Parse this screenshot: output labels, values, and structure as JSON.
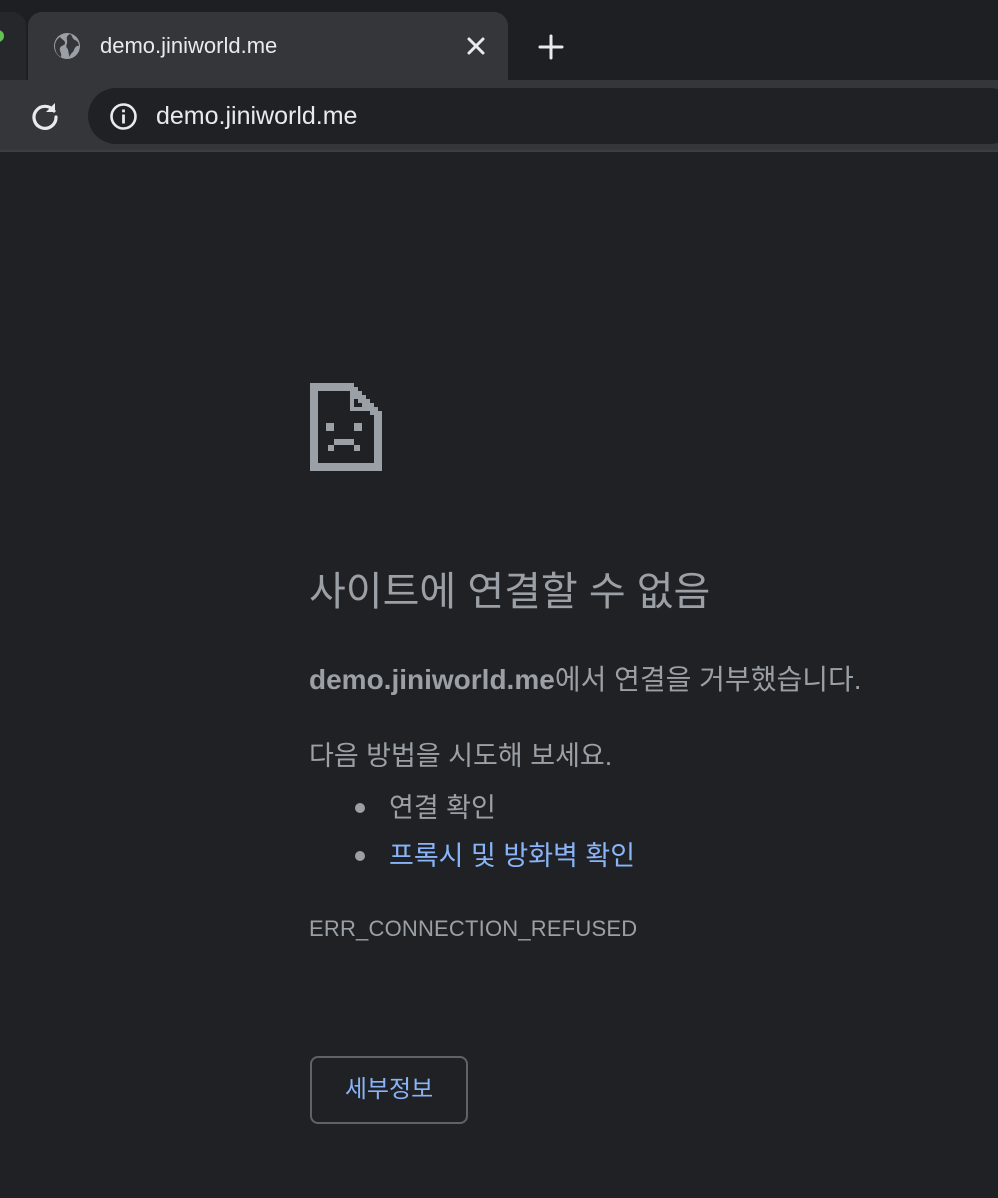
{
  "colors": {
    "tabstrip": "#1e1f22",
    "active_tab": "#35363a",
    "page_background": "#202124",
    "text_secondary": "#9aa0a6",
    "link": "#8ab4f8",
    "button_border": "#5f6368"
  },
  "browser": {
    "tab": {
      "title": "demo.jiniworld.me",
      "favicon": "globe-icon",
      "close_icon": "close-icon"
    },
    "new_tab_icon": "plus-icon",
    "toolbar": {
      "reload_icon": "reload-icon",
      "info_icon": "info-icon",
      "url": "demo.jiniworld.me"
    }
  },
  "error_page": {
    "icon": "sad-page-icon",
    "heading": "사이트에 연결할 수 없음",
    "summary_host": "demo.jiniworld.me",
    "summary_text": "에서 연결을 거부했습니다.",
    "suggestions_title": "다음 방법을 시도해 보세요.",
    "suggestions": [
      {
        "label": "연결 확인",
        "is_link": false
      },
      {
        "label": "프록시 및 방화벽 확인",
        "is_link": true
      }
    ],
    "error_code": "ERR_CONNECTION_REFUSED",
    "details_button": "세부정보"
  }
}
